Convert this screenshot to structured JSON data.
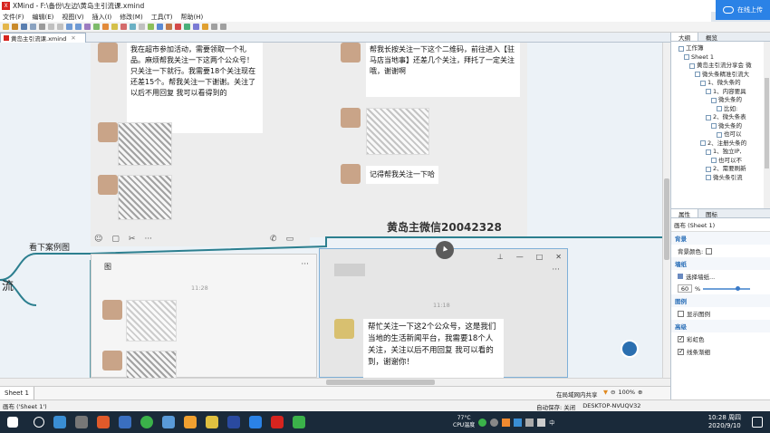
{
  "window": {
    "title": "XMind - F:\\备份\\左边\\黄岛主引流课.xmind",
    "app_badge": "X"
  },
  "cloud_button": {
    "label": "在线上传"
  },
  "menu": [
    "文件(F)",
    "编辑(E)",
    "视图(V)",
    "插入(I)",
    "修改(M)",
    "工具(T)",
    "帮助(H)"
  ],
  "document_tab": {
    "label": "黄岛主引流课.xmind",
    "close": "✕"
  },
  "canvas": {
    "bubble1": "我在超市参加活动，需要领取一个礼品。麻烦帮我关注一下这两个公众号！只关注一下就行。我需要18个关注现在还差15个。帮我关注一下谢谢。关注了以后不用回复 我可以看得到的",
    "bubble2": "帮我长按关注一下这个二维码，前往进入【驻马店当地事】还差几个关注，拜托了一定关注哦，谢谢啊",
    "bubble3": "记得帮我关注一下哈",
    "watermark": "黄岛主微信20042328",
    "node_case": "看下案例图",
    "node_flow": "流",
    "chat_left_title": "图",
    "chat_time1": "11:28",
    "chat_time2": "11:18",
    "bubble4": "帮忙关注一下这2个公众号，这是我们当地的生活新闻平台，我需要18个人关注，关注以后不用回复 我可以看的到，谢谢你！",
    "win_ctrls": [
      "—",
      "□",
      "✕"
    ],
    "more": "···",
    "pin": "⊥",
    "tool_icons": [
      "☺",
      "▢",
      "✂",
      "···",
      "✆",
      "▭"
    ]
  },
  "sheet": {
    "tab": "Sheet 1",
    "status": "在局域网内共享",
    "zoom": "100%"
  },
  "statusbar": {
    "left": "画布 ('Sheet 1')",
    "autosave": "自动保存: 关闭",
    "host": "DESKTOP-NVUQV32"
  },
  "right_panel": {
    "outline_tab": "大纲",
    "overview_tab": "概览",
    "outline_items": [
      {
        "label": "工作簿",
        "indent": 1
      },
      {
        "label": "Sheet 1",
        "indent": 2
      },
      {
        "label": "黄岛主引流分享会 微",
        "indent": 3
      },
      {
        "label": "微头条精准引流大",
        "indent": 4
      },
      {
        "label": "1、微头条的",
        "indent": 5
      },
      {
        "label": "1、内容要具",
        "indent": 6
      },
      {
        "label": "微头条的",
        "indent": 7
      },
      {
        "label": "比如:",
        "indent": 8
      },
      {
        "label": "2、微头条表",
        "indent": 6
      },
      {
        "label": "微头条的",
        "indent": 7
      },
      {
        "label": "也可以",
        "indent": 8
      },
      {
        "label": "2、注册头条的",
        "indent": 5
      },
      {
        "label": "1、独立IP,",
        "indent": 6
      },
      {
        "label": "也可以不",
        "indent": 7
      },
      {
        "label": "2、需要刷新",
        "indent": 6
      },
      {
        "label": "微头条引流",
        "indent": 6
      }
    ],
    "props_tab": "属性",
    "icons_tab": "图标",
    "props_title": "画布 (Sheet 1)",
    "sec_bg": "背景",
    "bg_color": "背景颜色:",
    "sec_wall": "墙纸",
    "choose_wall": "选择墙纸...",
    "opacity": "60",
    "pct_sign": "%",
    "sec_legend": "图例",
    "show_legend": "显示图例",
    "sec_advanced": "高级",
    "rainbow": "彩虹色",
    "gradient": "线条渐细"
  },
  "taskbar": {
    "temp": "77°C",
    "cpu": "CPU温度",
    "time": "10:28 周四",
    "date": "2020/9/10",
    "lang": "中"
  },
  "colors": {
    "accent": "#2b82e6",
    "brand": "#d6241f",
    "branch": "#2c7f8f"
  }
}
